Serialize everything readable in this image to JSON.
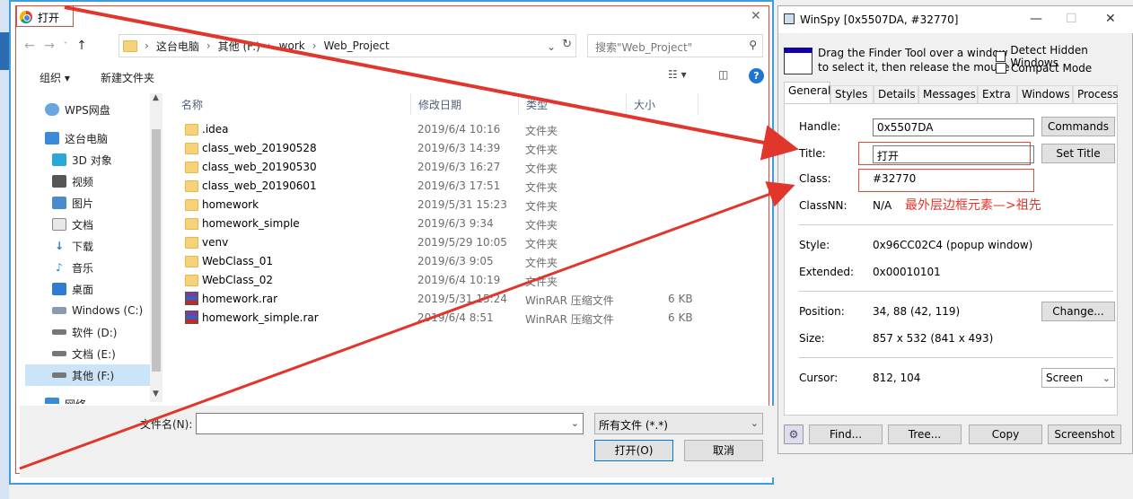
{
  "open_dialog": {
    "title": "打开",
    "breadcrumbs": [
      "这台电脑",
      "其他 (F:)",
      "work",
      "Web_Project"
    ],
    "search_placeholder": "搜索\"Web_Project\"",
    "toolbar": {
      "organize": "组织 ▾",
      "new_folder": "新建文件夹"
    },
    "nav_items": [
      {
        "label": "WPS网盘",
        "icon": "cloud-icon"
      },
      {
        "label": "这台电脑",
        "icon": "computer-icon"
      },
      {
        "label": "3D 对象",
        "icon": "3d-objects-icon"
      },
      {
        "label": "视频",
        "icon": "video-icon"
      },
      {
        "label": "图片",
        "icon": "picture-icon"
      },
      {
        "label": "文档",
        "icon": "document-icon"
      },
      {
        "label": "下载",
        "icon": "download-icon"
      },
      {
        "label": "音乐",
        "icon": "music-icon"
      },
      {
        "label": "桌面",
        "icon": "desktop-icon"
      },
      {
        "label": "Windows (C:)",
        "icon": "drive-icon"
      },
      {
        "label": "软件 (D:)",
        "icon": "drive-icon"
      },
      {
        "label": "文档 (E:)",
        "icon": "drive-icon"
      },
      {
        "label": "其他 (F:)",
        "icon": "drive-icon"
      },
      {
        "label": "网络",
        "icon": "network-icon"
      }
    ],
    "columns": {
      "name": "名称",
      "date": "修改日期",
      "type": "类型",
      "size": "大小"
    },
    "files": [
      {
        "name": ".idea",
        "date": "2019/6/4 10:16",
        "type": "文件夹",
        "size": "",
        "kind": "folder"
      },
      {
        "name": "class_web_20190528",
        "date": "2019/6/3 14:39",
        "type": "文件夹",
        "size": "",
        "kind": "folder"
      },
      {
        "name": "class_web_20190530",
        "date": "2019/6/3 16:27",
        "type": "文件夹",
        "size": "",
        "kind": "folder"
      },
      {
        "name": "class_web_20190601",
        "date": "2019/6/3 17:51",
        "type": "文件夹",
        "size": "",
        "kind": "folder"
      },
      {
        "name": "homework",
        "date": "2019/5/31 15:23",
        "type": "文件夹",
        "size": "",
        "kind": "folder"
      },
      {
        "name": "homework_simple",
        "date": "2019/6/3 9:34",
        "type": "文件夹",
        "size": "",
        "kind": "folder"
      },
      {
        "name": "venv",
        "date": "2019/5/29 10:05",
        "type": "文件夹",
        "size": "",
        "kind": "folder"
      },
      {
        "name": "WebClass_01",
        "date": "2019/6/3 9:05",
        "type": "文件夹",
        "size": "",
        "kind": "folder"
      },
      {
        "name": "WebClass_02",
        "date": "2019/6/4 10:19",
        "type": "文件夹",
        "size": "",
        "kind": "folder"
      },
      {
        "name": "homework.rar",
        "date": "2019/5/31 15:24",
        "type": "WinRAR 压缩文件",
        "size": "6 KB",
        "kind": "rar"
      },
      {
        "name": "homework_simple.rar",
        "date": "2019/6/4 8:51",
        "type": "WinRAR 压缩文件",
        "size": "6 KB",
        "kind": "rar"
      }
    ],
    "filename_label": "文件名(N):",
    "filename_value": "",
    "filter_value": "所有文件 (*.*)",
    "open_button": "打开(O)",
    "cancel_button": "取消"
  },
  "winspy": {
    "title": "WinSpy [0x5507DA, #32770]",
    "finder_text_1": "Drag the Finder Tool over a window",
    "finder_text_2": "to select it, then release the mouse",
    "detect_hidden": "Detect Hidden Windows",
    "compact_mode": "Compact Mode",
    "tabs": [
      "General",
      "Styles",
      "Details",
      "Messages",
      "Extra",
      "Windows",
      "Process"
    ],
    "active_tab": "General",
    "handle_label": "Handle:",
    "handle_value": "0x5507DA",
    "commands_button": "Commands",
    "title_label": "Title:",
    "title_value": "打开",
    "set_title_button": "Set Title",
    "class_label": "Class:",
    "class_value": "#32770",
    "classnn_label": "ClassNN:",
    "classnn_value": "N/A",
    "annotation": "最外层边框元素—>祖先",
    "style_label": "Style:",
    "style_value": "0x96CC02C4 (popup window)",
    "extended_label": "Extended:",
    "extended_value": "0x00010101",
    "position_label": "Position:",
    "position_value": "34, 88 (42, 119)",
    "change_button": "Change...",
    "size_label": "Size:",
    "size_value": "857 x 532 (841 x 493)",
    "cursor_label": "Cursor:",
    "cursor_value": "812, 104",
    "screen_select": "Screen",
    "find_button": "Find...",
    "tree_button": "Tree...",
    "copy_button": "Copy",
    "screenshot_button": "Screenshot"
  },
  "colors": {
    "accent_border": "#3d9de0",
    "annotation_red": "#e0362c",
    "selection": "#cce4f7"
  }
}
